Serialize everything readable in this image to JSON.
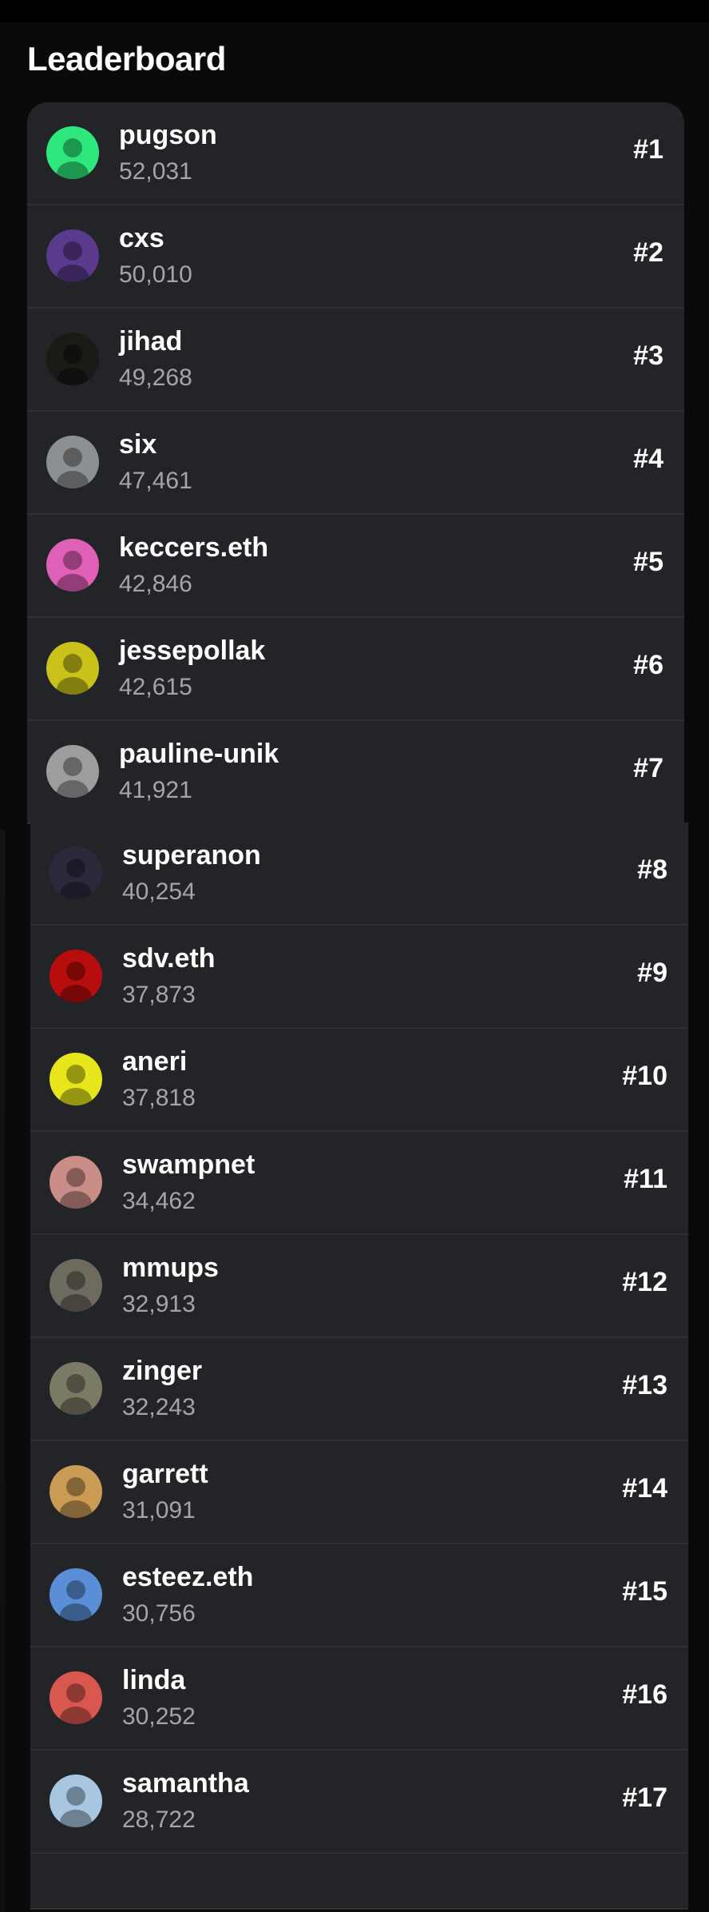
{
  "title": "Leaderboard",
  "entries": [
    {
      "name": "pugson",
      "score": "52,031",
      "rank": "#1",
      "avatar": "avatar-pugson",
      "color": "#2ee87d"
    },
    {
      "name": "cxs",
      "score": "50,010",
      "rank": "#2",
      "avatar": "avatar-cxs",
      "color": "#5a3a8c"
    },
    {
      "name": "jihad",
      "score": "49,268",
      "rank": "#3",
      "avatar": "avatar-jihad",
      "color": "#1b1a16"
    },
    {
      "name": "six",
      "score": "47,461",
      "rank": "#4",
      "avatar": "avatar-six",
      "color": "#8d9092"
    },
    {
      "name": "keccers.eth",
      "score": "42,846",
      "rank": "#5",
      "avatar": "avatar-keccers",
      "color": "#e05fb7"
    },
    {
      "name": "jessepollak",
      "score": "42,615",
      "rank": "#6",
      "avatar": "avatar-jessepollak",
      "color": "#c9c21a"
    },
    {
      "name": "pauline-unik",
      "score": "41,921",
      "rank": "#7",
      "avatar": "avatar-pauline-unik",
      "color": "#9d9d9d"
    },
    {
      "name": "superanon",
      "score": "40,254",
      "rank": "#8",
      "avatar": "avatar-superanon",
      "color": "#2b2a3d"
    },
    {
      "name": "sdv.eth",
      "score": "37,873",
      "rank": "#9",
      "avatar": "avatar-sdv",
      "color": "#b80d0d"
    },
    {
      "name": "aneri",
      "score": "37,818",
      "rank": "#10",
      "avatar": "avatar-aneri",
      "color": "#e6e61a"
    },
    {
      "name": "swampnet",
      "score": "34,462",
      "rank": "#11",
      "avatar": "avatar-swampnet",
      "color": "#c98c86"
    },
    {
      "name": "mmups",
      "score": "32,913",
      "rank": "#12",
      "avatar": "avatar-mmups",
      "color": "#6e6a5e"
    },
    {
      "name": "zinger",
      "score": "32,243",
      "rank": "#13",
      "avatar": "avatar-zinger",
      "color": "#7b7a64"
    },
    {
      "name": "garrett",
      "score": "31,091",
      "rank": "#14",
      "avatar": "avatar-garrett",
      "color": "#c99b55"
    },
    {
      "name": "esteez.eth",
      "score": "30,756",
      "rank": "#15",
      "avatar": "avatar-esteez",
      "color": "#5a8fd8"
    },
    {
      "name": "linda",
      "score": "30,252",
      "rank": "#16",
      "avatar": "avatar-linda",
      "color": "#d9574e"
    },
    {
      "name": "samantha",
      "score": "28,722",
      "rank": "#17",
      "avatar": "avatar-samantha",
      "color": "#a8c6e0"
    }
  ]
}
